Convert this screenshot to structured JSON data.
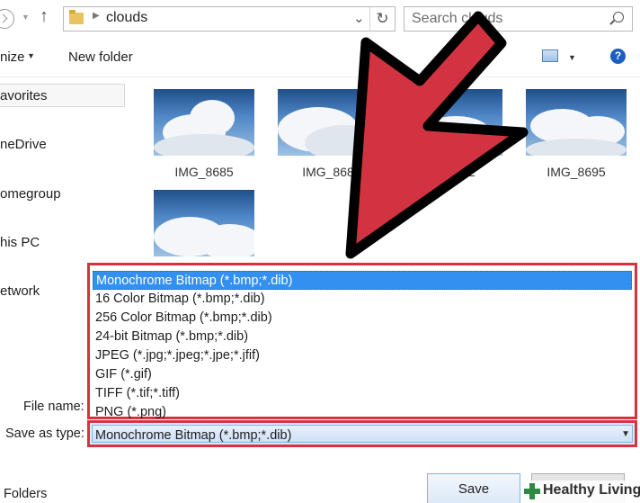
{
  "address_bar": {
    "path": "clouds",
    "search_placeholder": "Search clouds"
  },
  "toolbar": {
    "organize_label": "nize",
    "new_folder_label": "New folder",
    "help_glyph": "?"
  },
  "nav": {
    "items": [
      {
        "label": "avorites"
      },
      {
        "label": "neDrive"
      },
      {
        "label": "omegroup"
      },
      {
        "label": "his PC"
      },
      {
        "label": "etwork"
      }
    ]
  },
  "files": [
    {
      "name": "IMG_8685"
    },
    {
      "name": "IMG_868"
    },
    {
      "name": "02"
    },
    {
      "name": "IMG_8695"
    }
  ],
  "save_type_dropdown": {
    "options": [
      "Monochrome Bitmap (*.bmp;*.dib)",
      "16 Color Bitmap (*.bmp;*.dib)",
      "256 Color Bitmap (*.bmp;*.dib)",
      "24-bit Bitmap (*.bmp;*.dib)",
      "JPEG (*.jpg;*.jpeg;*.jpe;*.jfif)",
      "GIF (*.gif)",
      "TIFF (*.tif;*.tiff)",
      "PNG (*.png)"
    ],
    "selected_index": 0
  },
  "form": {
    "file_name_label": "File name:",
    "save_as_type_label": "Save as type:",
    "save_as_type_value": "Monochrome Bitmap (*.bmp;*.dib)",
    "folders_label": "Folders",
    "save_button": "Save"
  },
  "watermark": {
    "text": "Healthy Living"
  },
  "colors": {
    "highlight_red": "#d8323f",
    "selection_blue": "#3390f0"
  }
}
